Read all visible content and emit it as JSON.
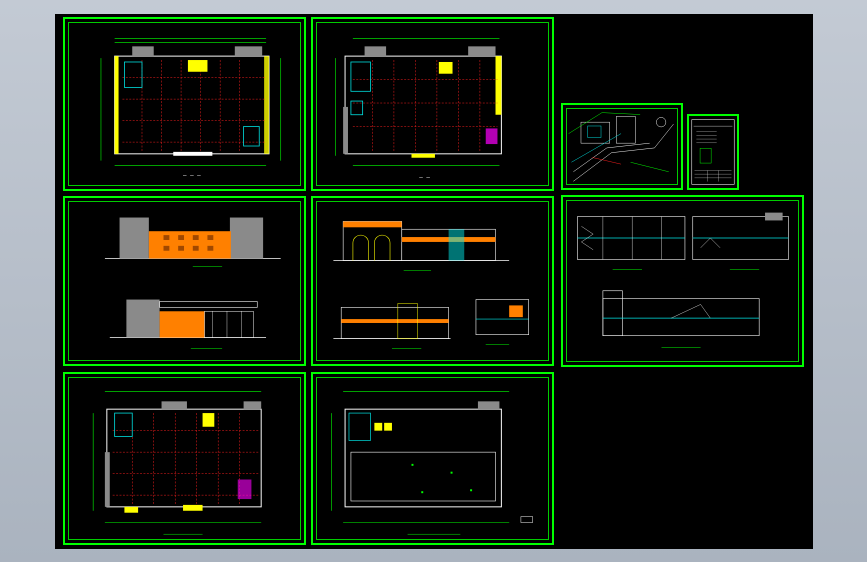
{
  "window": {
    "title": "",
    "background": "#000000",
    "sheet_border_color": "#00ff00"
  },
  "sheets": [
    {
      "id": "floor-plan-1",
      "type": "floor-plan",
      "caption": ""
    },
    {
      "id": "floor-plan-2",
      "type": "floor-plan",
      "caption": ""
    },
    {
      "id": "site-plan",
      "type": "site-plan",
      "caption": ""
    },
    {
      "id": "title-block",
      "type": "index",
      "caption": ""
    },
    {
      "id": "elevations-1",
      "type": "elevation",
      "caption": ""
    },
    {
      "id": "elevations-2",
      "type": "elevation",
      "caption": ""
    },
    {
      "id": "sections",
      "type": "section",
      "caption": ""
    },
    {
      "id": "floor-plan-3",
      "type": "floor-plan",
      "caption": ""
    },
    {
      "id": "roof-plan",
      "type": "roof-plan",
      "caption": ""
    }
  ],
  "colors": {
    "grid_red": "#ff2020",
    "wall_cyan": "#00e5e5",
    "dim_green": "#00ff00",
    "accent_yellow": "#ffff00",
    "facade_orange": "#ff8000",
    "hatch_gray": "#8a8a8a",
    "line_white": "#ffffff",
    "accent_magenta": "#ff00ff"
  }
}
